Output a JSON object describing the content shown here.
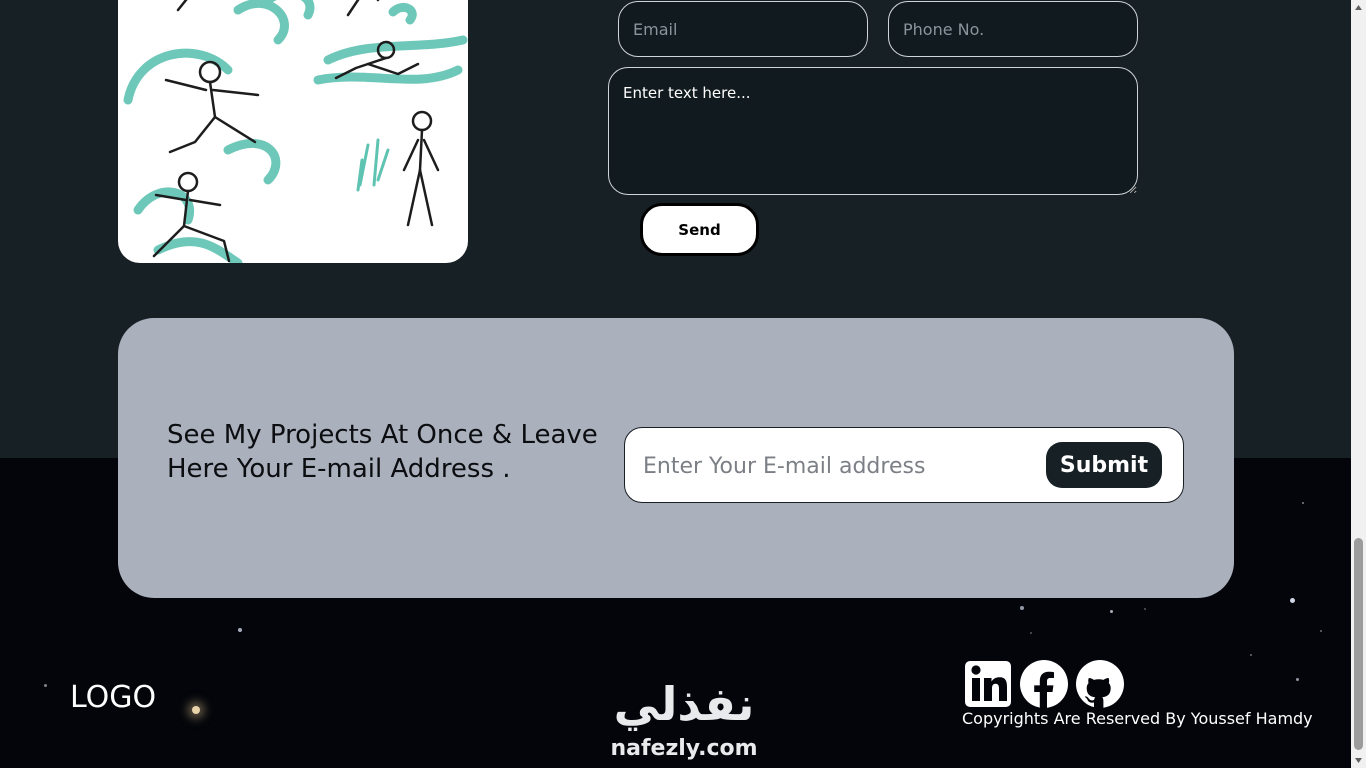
{
  "contact_form": {
    "email_placeholder": "Email",
    "phone_placeholder": "Phone No.",
    "message_placeholder": "Enter text here...",
    "send_label": "Send"
  },
  "newsletter": {
    "heading_line1": "See My Projects At Once & Leave",
    "heading_line2": "Here Your E-mail Address .",
    "input_placeholder": "Enter Your E-mail address",
    "submit_label": "Submit"
  },
  "footer": {
    "logo_text": "LOGO",
    "copyright": "Copyrights Are Reserved By Youssef Hamdy",
    "social_icons": [
      "linkedin-icon",
      "facebook-icon",
      "github-icon"
    ]
  },
  "watermark": {
    "arabic": "نفذلي",
    "latin": "nafezly.com"
  },
  "colors": {
    "top_background": "#172125",
    "bottom_background": "#03050a",
    "newsletter_card": "#aab0bc",
    "submit_button": "#172125",
    "illustration_accent": "#5fc3b2"
  }
}
